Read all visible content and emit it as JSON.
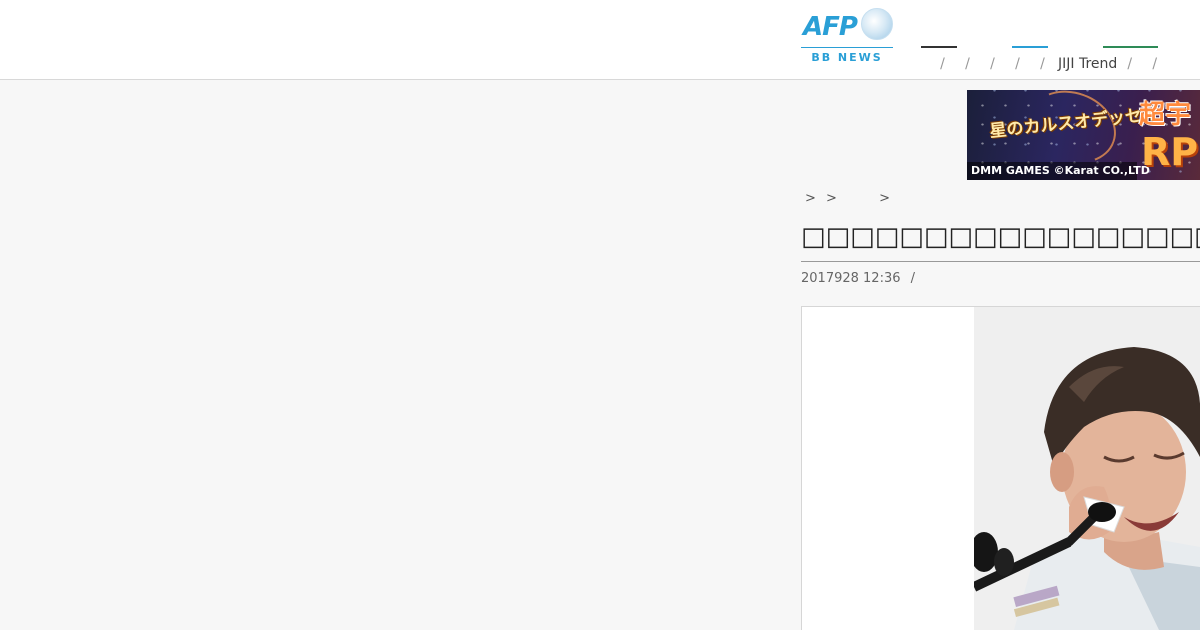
{
  "header": {
    "logo": {
      "brand": "AFP",
      "sub": "BB NEWS"
    },
    "nav": {
      "items": [
        "",
        "",
        "",
        "",
        "",
        "JIJI Trend",
        "",
        ""
      ],
      "accent_colors": [
        "#333333",
        "#2a9fd6",
        "#2e8b57"
      ]
    }
  },
  "ad": {
    "game_logo": "星のカルスオデッセイ",
    "footer": "DMM GAMES ©Karat CO.,LTD",
    "headline_1": "超宇",
    "headline_2": "RP"
  },
  "article": {
    "breadcrumb": [
      ">",
      ">",
      ">"
    ],
    "title": "□□□□□□□□□□□□□□□□□□□□□□□□□□□□□□□□□□□□",
    "date": "2017928 12:36",
    "meta_sep": "/"
  },
  "colors": {
    "brand_blue": "#2a9fd6",
    "page_bg": "#f7f7f7",
    "header_bg": "#ffffff"
  }
}
